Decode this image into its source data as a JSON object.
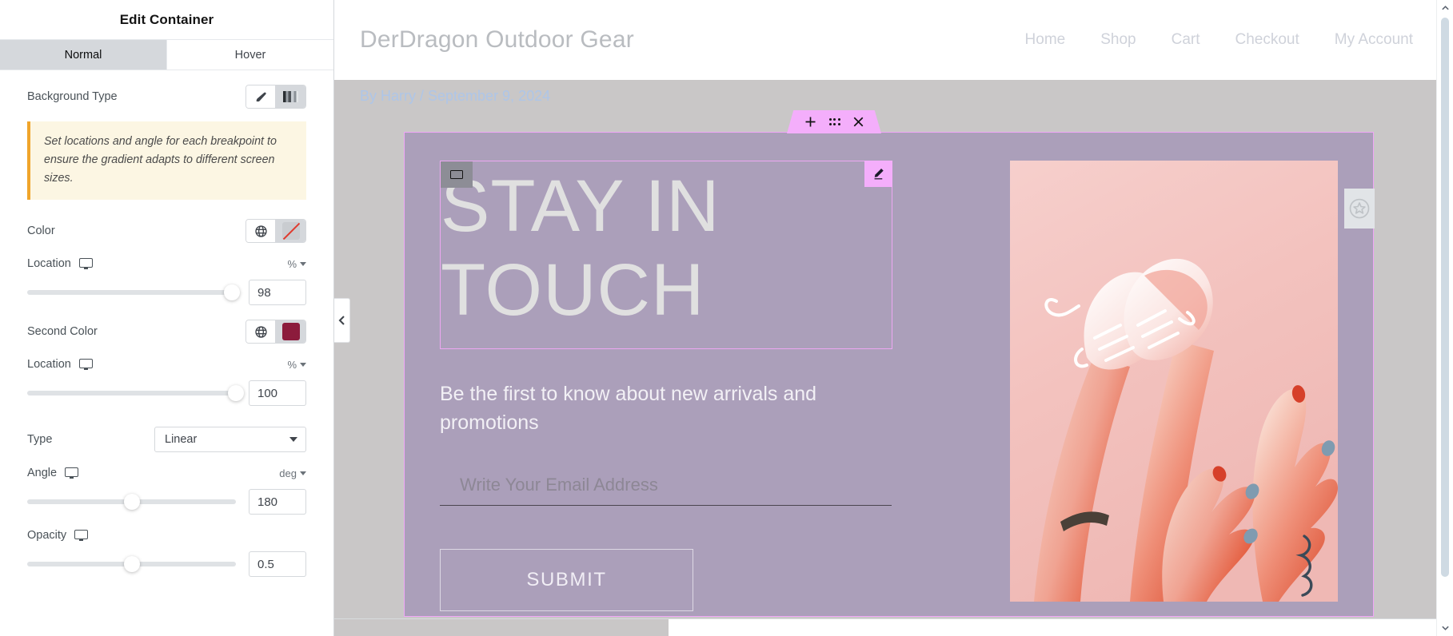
{
  "panel": {
    "title": "Edit Container",
    "tabs": [
      {
        "label": "Normal",
        "active": true
      },
      {
        "label": "Hover",
        "active": false
      }
    ],
    "controls": {
      "background_type": {
        "label": "Background Type",
        "options": [
          {
            "name": "classic",
            "icon": "paintbrush-icon",
            "active": false
          },
          {
            "name": "gradient",
            "icon": "gradient-bars-icon",
            "active": true
          }
        ]
      },
      "notice": "Set locations and angle for each breakpoint to ensure the gradient adapts to different screen sizes.",
      "color": {
        "label": "Color",
        "global_icon": "globe-icon",
        "swatch": "none",
        "swatch_color": "#c9ccd0"
      },
      "color_location": {
        "label": "Location",
        "device_icon": "desktop-icon",
        "unit": "%",
        "value": "98",
        "percent": 98
      },
      "second_color": {
        "label": "Second Color",
        "global_icon": "globe-icon",
        "swatch_color": "#8c1b3c"
      },
      "second_color_location": {
        "label": "Location",
        "device_icon": "desktop-icon",
        "unit": "%",
        "value": "100",
        "percent": 100
      },
      "type": {
        "label": "Type",
        "value": "Linear",
        "options": [
          "Linear",
          "Radial"
        ]
      },
      "angle": {
        "label": "Angle",
        "device_icon": "desktop-icon",
        "unit": "deg",
        "value": "180",
        "percent": 50
      },
      "opacity": {
        "label": "Opacity",
        "device_icon": "desktop-icon",
        "value": "0.5",
        "percent": 50
      }
    }
  },
  "collapse_handle": {
    "icon": "chevron-left-icon"
  },
  "preview": {
    "site": {
      "logo": "DerDragon Outdoor Gear",
      "nav": [
        {
          "label": "Home"
        },
        {
          "label": "Shop"
        },
        {
          "label": "Cart"
        },
        {
          "label": "Checkout"
        },
        {
          "label": "My Account"
        }
      ],
      "byline": "By Harry / September 9, 2024"
    },
    "selection_toolbar": {
      "add": "+",
      "drag": "drag-handle-icon",
      "close": "×"
    },
    "star_tab": {
      "icon": "star-icon"
    },
    "container": {
      "heading": "STAY IN TOUCH",
      "heading_badge_icon": "container-rect-icon",
      "heading_edit_icon": "pencil-edit-icon",
      "subtitle": "Be the first to know about new arrivals and promotions",
      "email_placeholder": "Write Your Email Address",
      "submit_label": "SUBMIT"
    },
    "photo": {
      "alt": "legs-wearing-white-sneakers-with-hands-photo"
    }
  },
  "scrollbar": {
    "up_icon": "chevron-up-icon",
    "down_icon": "chevron-down-icon"
  },
  "colors": {
    "overlay": "#ab9fba",
    "selection_outline": "#f0a6f7",
    "toolbar_pink": "#f4aefb",
    "canvas_gray": "#c9c7c7",
    "notice_bg": "#fcf6e3",
    "notice_accent": "#f0a52b",
    "second_color": "#8c1b3c"
  }
}
